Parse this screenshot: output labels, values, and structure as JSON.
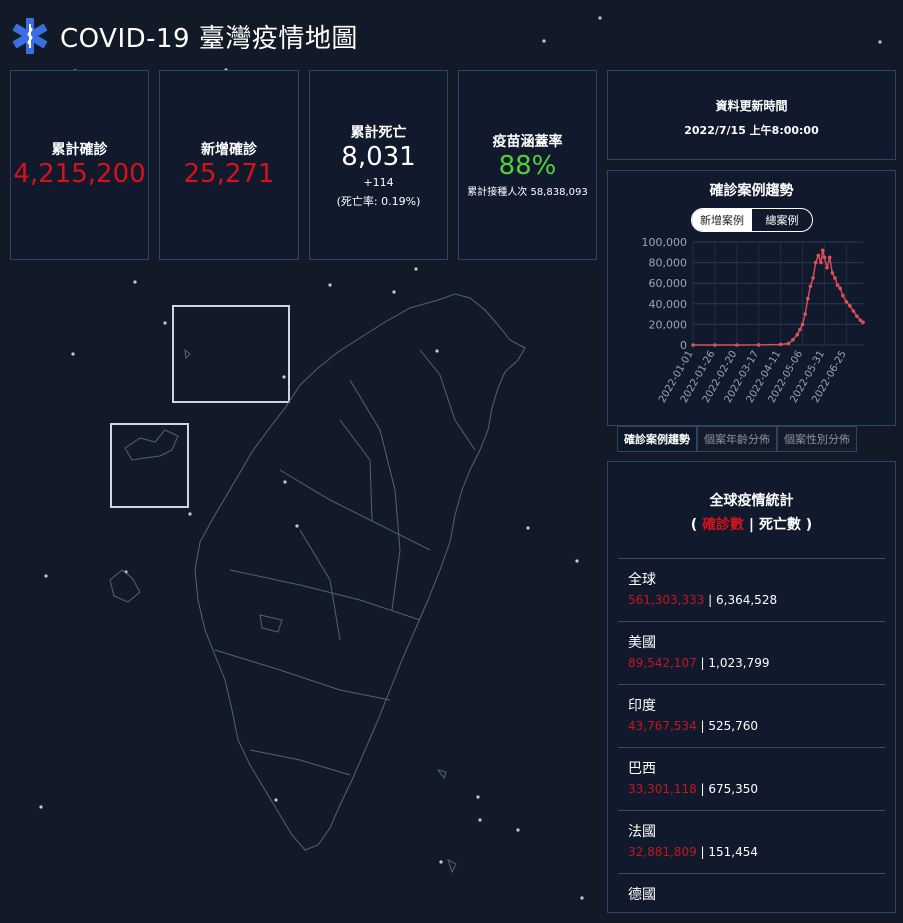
{
  "header": {
    "title": "COVID-19 臺灣疫情地圖",
    "logo_icon": "star-of-life-icon"
  },
  "stats": {
    "cumulative_cases": {
      "label": "累計確診",
      "value": "4,215,200"
    },
    "new_cases": {
      "label": "新增確診",
      "value": "25,271"
    },
    "deaths": {
      "label": "累計死亡",
      "value": "8,031",
      "delta": "+114",
      "rate": "(死亡率: 0.19%)"
    },
    "vaccine": {
      "label": "疫苗涵蓋率",
      "value": "88%",
      "sub": "累計接種人次 58,838,093"
    }
  },
  "update": {
    "label": "資料更新時間",
    "value": "2022/7/15 上午8:00:00"
  },
  "trend": {
    "title": "確診案例趨勢",
    "toggle": [
      "新增案例",
      "總案例"
    ]
  },
  "tabs": [
    "確診案例趨勢",
    "個案年齡分佈",
    "個案性別分佈"
  ],
  "global": {
    "title": "全球疫情統計",
    "subtitle_open": "( ",
    "subtitle_cases": "確診數",
    "subtitle_sep": " | ",
    "subtitle_deaths": "死亡數",
    "subtitle_close": " )",
    "rows": [
      {
        "country": "全球",
        "cases": "561,303,333",
        "deaths": "6,364,528"
      },
      {
        "country": "美國",
        "cases": "89,542,107",
        "deaths": "1,023,799"
      },
      {
        "country": "印度",
        "cases": "43,767,534",
        "deaths": "525,760"
      },
      {
        "country": "巴西",
        "cases": "33,301,118",
        "deaths": "675,350"
      },
      {
        "country": "法國",
        "cases": "32,881,809",
        "deaths": "151,454"
      },
      {
        "country": "德國",
        "cases": "",
        "deaths": ""
      }
    ]
  },
  "chart_data": {
    "type": "line",
    "title": "",
    "xlabel": "",
    "ylabel": "",
    "ylim": [
      0,
      100000
    ],
    "yticks": [
      "100,000",
      "80,000",
      "60,000",
      "40,000",
      "20,000",
      "0"
    ],
    "xticks": [
      "2022-01-01",
      "2022-01-26",
      "2022-02-20",
      "2022-03-17",
      "2022-04-11",
      "2022-05-06",
      "2022-05-31",
      "2022-06-25"
    ],
    "color": "#e0505a",
    "x": [
      "2022-01-01",
      "2022-01-26",
      "2022-02-20",
      "2022-03-17",
      "2022-04-11",
      "2022-04-20",
      "2022-04-25",
      "2022-04-30",
      "2022-05-03",
      "2022-05-06",
      "2022-05-09",
      "2022-05-12",
      "2022-05-15",
      "2022-05-18",
      "2022-05-21",
      "2022-05-24",
      "2022-05-27",
      "2022-05-29",
      "2022-05-31",
      "2022-06-03",
      "2022-06-06",
      "2022-06-09",
      "2022-06-12",
      "2022-06-15",
      "2022-06-18",
      "2022-06-21",
      "2022-06-25",
      "2022-06-29",
      "2022-07-03",
      "2022-07-07",
      "2022-07-11",
      "2022-07-14"
    ],
    "y": [
      0,
      0,
      0,
      50,
      500,
      1500,
      5000,
      10000,
      15000,
      20000,
      30000,
      45000,
      57000,
      65000,
      80000,
      87000,
      80000,
      92000,
      85000,
      75000,
      85000,
      70000,
      65000,
      58000,
      55000,
      48000,
      42000,
      38000,
      33000,
      28000,
      24000,
      22000
    ]
  },
  "colors": {
    "cases": "#d4121d",
    "vaccine": "#53cf3a",
    "panel_border": "#2d4562",
    "background": "#131a27"
  }
}
